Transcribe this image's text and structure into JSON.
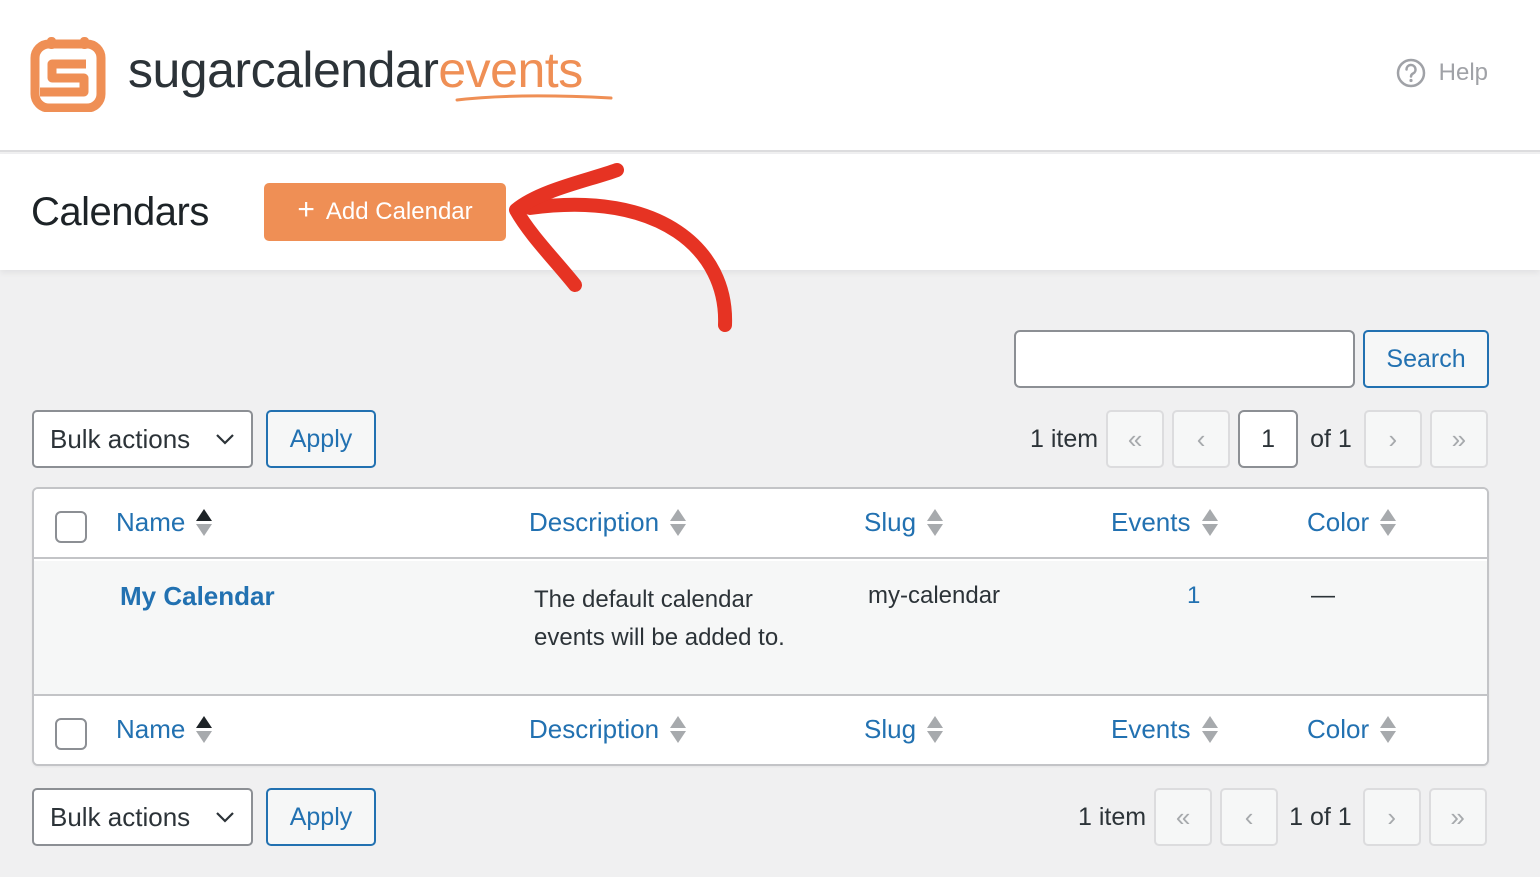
{
  "brand": {
    "name_part1": "sugarcalendar",
    "name_part2": "events",
    "logo_icon": "sugar-calendar-logo-icon",
    "accent_color": "#ef8f55"
  },
  "header": {
    "help_label": "Help",
    "help_icon": "question-circle-icon"
  },
  "page": {
    "title": "Calendars",
    "add_button_label": "Add Calendar",
    "add_button_icon": "plus-icon",
    "annotation": "red-arrow-pointing-to-add-calendar"
  },
  "search": {
    "value": "",
    "placeholder": "",
    "button_label": "Search"
  },
  "toolbar_top": {
    "bulk_actions_label": "Bulk actions",
    "apply_label": "Apply",
    "item_count": "1 item",
    "first_page": "«",
    "prev_page": "‹",
    "current_page": "1",
    "of_total": "of 1",
    "next_page": "›",
    "last_page": "»"
  },
  "toolbar_bottom": {
    "bulk_actions_label": "Bulk actions",
    "apply_label": "Apply",
    "item_count": "1 item",
    "first_page": "«",
    "prev_page": "‹",
    "page_status": "1 of 1",
    "next_page": "›",
    "last_page": "»"
  },
  "table": {
    "columns": [
      {
        "label": "Name",
        "sorted": true
      },
      {
        "label": "Description",
        "sorted": false
      },
      {
        "label": "Slug",
        "sorted": false
      },
      {
        "label": "Events",
        "sorted": false
      },
      {
        "label": "Color",
        "sorted": false
      }
    ],
    "rows": [
      {
        "name": "My Calendar",
        "description_line1": "The default calendar",
        "description_line2": "events will be added to.",
        "slug": "my-calendar",
        "events": "1",
        "color": "—"
      }
    ]
  }
}
